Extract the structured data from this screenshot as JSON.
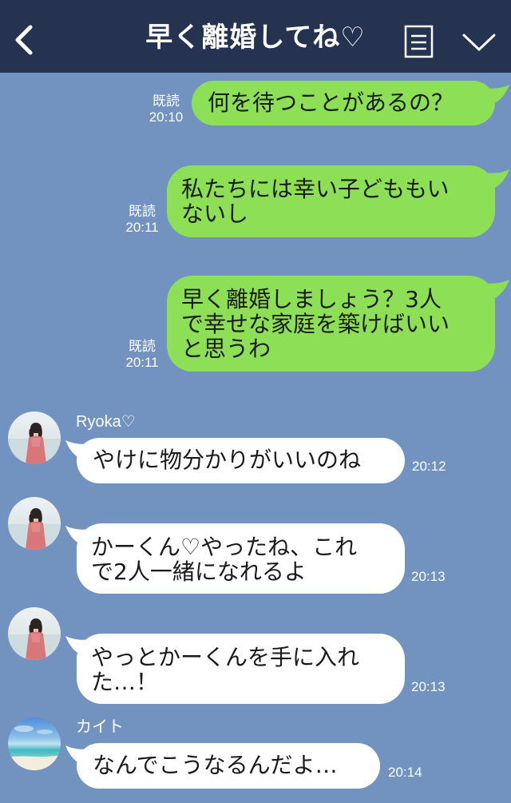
{
  "colors": {
    "background": "#7293c0",
    "header": "#253350",
    "outgoing_bubble": "#8de055",
    "incoming_bubble": "#ffffff"
  },
  "header": {
    "title": "早く離婚してね♡",
    "back_icon": "chevron-left-icon",
    "menu_icon": "list-icon",
    "expand_icon": "chevron-down-icon"
  },
  "messages": {
    "m1": {
      "text": "何を待つことがあるの？",
      "read": "既読",
      "time": "20:10"
    },
    "m2": {
      "line1": "私たちには幸い子どももい",
      "line2": "ないし",
      "read": "既読",
      "time": "20:11"
    },
    "m3": {
      "line1": "早く離婚しましょう？3人",
      "line2": "で幸せな家庭を築けばいい",
      "line3": "と思うわ",
      "read": "既読",
      "time": "20:11"
    },
    "m4": {
      "sender": "Ryoka♡",
      "text": "やけに物分かりがいいのね",
      "time": "20:12"
    },
    "m5": {
      "line1": "かーくん♡やったね、これ",
      "line2": "で2人一緒になれるよ",
      "time": "20:13"
    },
    "m6": {
      "line1": "やっとかーくんを手に入れ",
      "line2": "た…！",
      "time": "20:13"
    },
    "m7": {
      "sender": "カイト",
      "text": "なんでこうなるんだよ…",
      "time": "20:14"
    }
  }
}
